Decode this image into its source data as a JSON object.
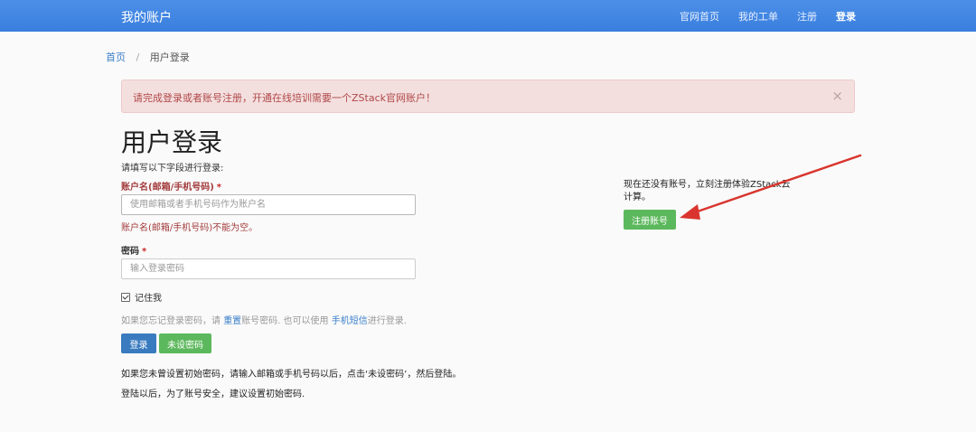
{
  "navbar": {
    "brand": "我的账户",
    "links": [
      "官网首页",
      "我的工单",
      "注册",
      "登录"
    ]
  },
  "breadcrumb": {
    "home": "首页",
    "separator": "/",
    "current": "用户登录"
  },
  "alert": {
    "message": "请完成登录或者账号注册，开通在线培训需要一个ZStack官网账户！",
    "close": "×"
  },
  "login": {
    "title": "用户登录",
    "intro": "请填写以下字段进行登录:",
    "account_label": "账户名(邮箱/手机号码)",
    "account_placeholder": "使用邮箱或者手机号码作为账户名",
    "account_value": "",
    "account_error": "账户名(邮箱/手机号码)不能为空。",
    "password_label": "密码",
    "password_placeholder": "输入登录密码",
    "password_value": "",
    "required_mark": "*",
    "remember_label": "记住我",
    "remember_checked": true,
    "help": {
      "prefix": "如果您忘记登录密码，请",
      "reset_link": "重置",
      "middle": "账号密码. 也可以使用",
      "sms_link": "手机短信",
      "suffix": "进行登录."
    },
    "login_button": "登录",
    "no_password_button": "未设密码",
    "note1": "如果您未曾设置初始密码，请输入邮箱或手机号码以后，点击‘未设密码’，然后登陆。",
    "note2": "登陆以后，为了账号安全，建议设置初始密码."
  },
  "register": {
    "text": "现在还没有账号，立刻注册体验ZStack云计算。",
    "button": "注册账号"
  },
  "colors": {
    "navbar": "#3a7fde",
    "alert_bg": "#f4dfdf",
    "alert_text": "#b04848",
    "primary_button": "#3a7bbf",
    "success_button": "#5cb85c",
    "annotation_arrow": "#d9352e"
  }
}
